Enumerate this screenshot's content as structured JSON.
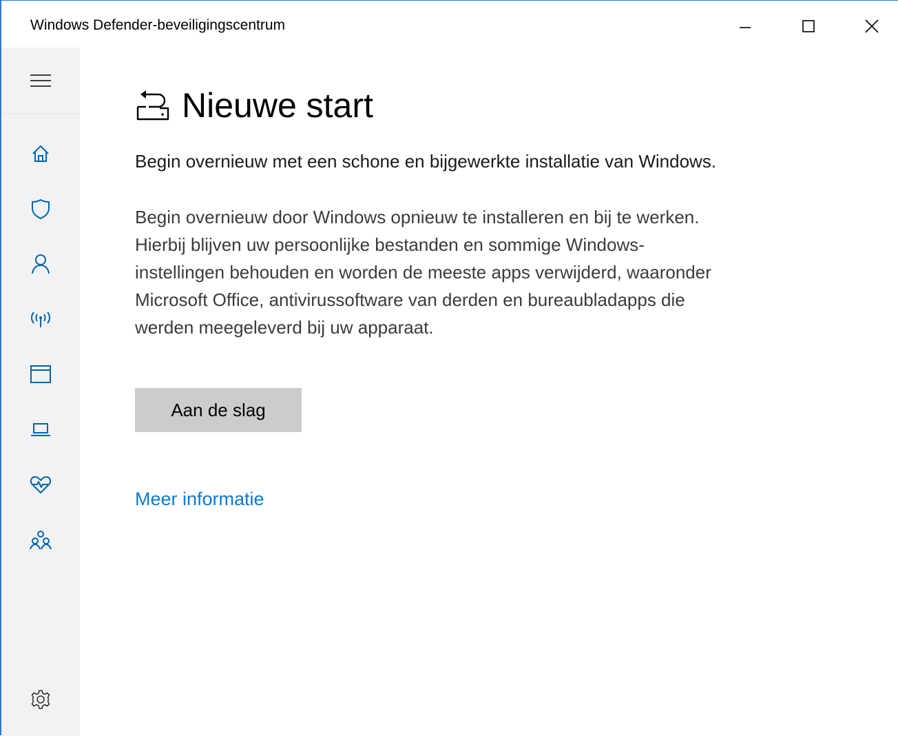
{
  "window": {
    "title": "Windows Defender-beveiligingscentrum",
    "controls": [
      "minimize",
      "maximize",
      "close"
    ]
  },
  "sidebar": {
    "menu_icon": "hamburger-menu-icon",
    "items": [
      {
        "id": "home",
        "icon": "home-icon"
      },
      {
        "id": "virus-protection",
        "icon": "shield-icon"
      },
      {
        "id": "account-protection",
        "icon": "person-icon"
      },
      {
        "id": "firewall-network",
        "icon": "wifi-antenna-icon"
      },
      {
        "id": "app-browser-control",
        "icon": "browser-window-icon"
      },
      {
        "id": "device-security",
        "icon": "laptop-icon"
      },
      {
        "id": "device-performance-health",
        "icon": "heart-pulse-icon"
      },
      {
        "id": "family-options",
        "icon": "family-icon"
      }
    ],
    "settings_icon": "gear-icon"
  },
  "main": {
    "title_icon": "fresh-start-icon",
    "title": "Nieuwe start",
    "subtitle": "Begin overnieuw met een schone en bijgewerkte installatie van Windows.",
    "description_lines": [
      "Begin overnieuw door Windows opnieuw te installeren en bij te werken.",
      "Hierbij blijven uw persoonlijke bestanden en sommige Windows-",
      "instellingen behouden en worden de meeste apps verwijderd, waaronder",
      "Microsoft Office, antivirussoftware van derden en bureaubladapps die",
      "werden meegeleverd bij uw apparaat."
    ],
    "button_label": "Aan de slag",
    "link_label": "Meer informatie"
  },
  "colors": {
    "accent_blue": "#0a7ad6",
    "sidebar_icon_blue": "#0063b1",
    "sidebar_bg": "#f2f2f2",
    "button_bg": "#cccccc",
    "window_border": "#2b79d0"
  }
}
